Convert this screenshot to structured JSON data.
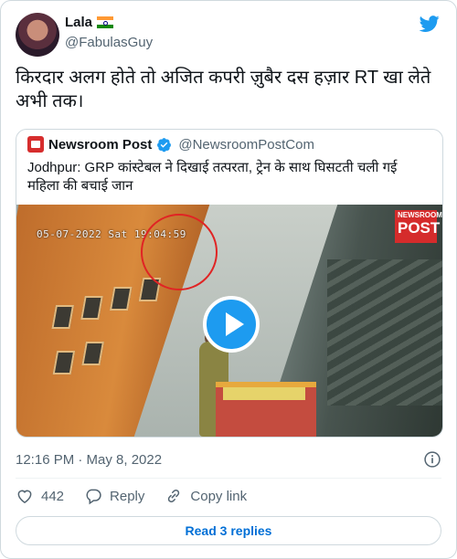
{
  "author": {
    "name": "Lala",
    "flag_icon": "india-flag-icon",
    "handle": "@FabulasGuy"
  },
  "brand_icon": "twitter-bird-icon",
  "tweet_text": "किरदार अलग होते तो अजित कपरी ज़ुबैर दस हज़ार RT खा लेते अभी तक।",
  "quote": {
    "source_name": "Newsroom Post",
    "verified_icon": "verified-badge-icon",
    "handle": "@NewsroomPostCom",
    "text": "Jodhpur: GRP कांस्टेबल ने दिखाई तत्परता, ट्रेन के साथ घिसटती चली गई महिला की बचाई जान",
    "video": {
      "timestamp_overlay": "05-07-2022 Sat 19:04:59",
      "logo_small": "NEWSROOM",
      "logo_big": "POST",
      "play_icon": "play-icon"
    }
  },
  "posted_at": "12:16 PM · May 8, 2022",
  "info_icon": "info-icon",
  "actions": {
    "like_count": "442",
    "reply_label": "Reply",
    "copy_label": "Copy link"
  },
  "read_replies_label": "Read 3 replies",
  "colors": {
    "twitter_blue": "#1d9bf0",
    "link_blue": "#006fd6",
    "secondary_text": "#536471",
    "border": "#cfd9de"
  }
}
